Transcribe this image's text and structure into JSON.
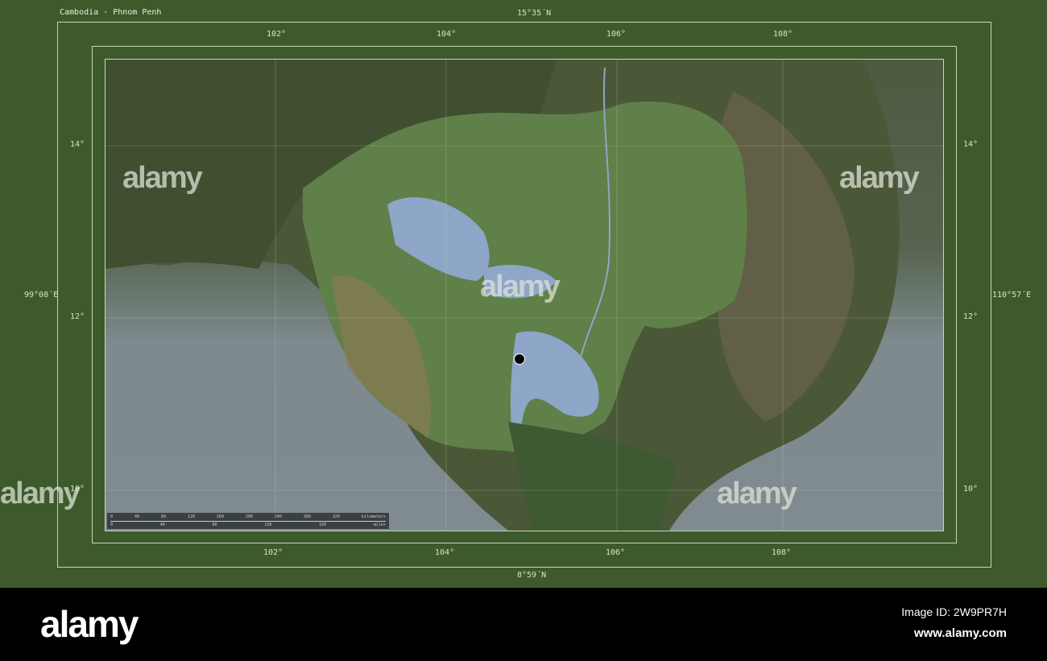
{
  "title": "Cambodia - Phnom Penh",
  "lat_top": "15°35´N",
  "lat_bottom": "8°59´N",
  "lon_left": "99°08´E",
  "lon_right": "110°57´E",
  "lon_ticks": [
    "102°",
    "104°",
    "106°",
    "108°"
  ],
  "lat_ticks": [
    "14°",
    "12°",
    "10°"
  ],
  "scale": {
    "km": [
      "0",
      "40",
      "80",
      "120",
      "160",
      "200",
      "240",
      "280",
      "320"
    ],
    "km_unit": "kilometers",
    "mi": [
      "0",
      "40",
      "80",
      "120",
      "160"
    ],
    "mi_unit": "miles"
  },
  "marker": "Phnom Penh",
  "watermark": "alamy",
  "footer": {
    "logo": "alamy",
    "image_id": "Image ID: 2W9PR7H",
    "site": "www.alamy.com"
  }
}
